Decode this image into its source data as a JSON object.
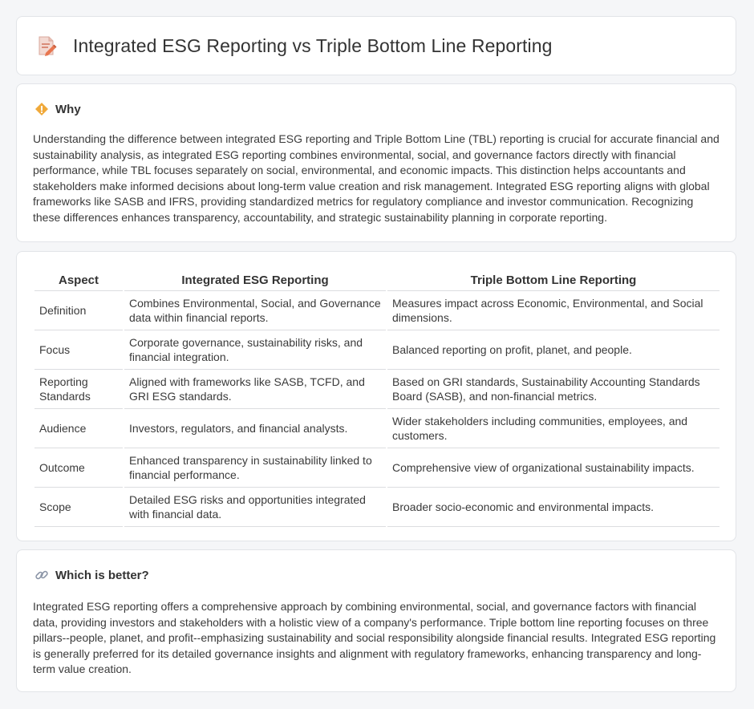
{
  "header": {
    "title": "Integrated ESG Reporting vs Triple Bottom Line Reporting",
    "icon": "document-pencil-icon"
  },
  "why": {
    "title": "Why",
    "icon": "warning-diamond-icon",
    "body": "Understanding the difference between integrated ESG reporting and Triple Bottom Line (TBL) reporting is crucial for accurate financial and sustainability analysis, as integrated ESG reporting combines environmental, social, and governance factors directly with financial performance, while TBL focuses separately on social, environmental, and economic impacts. This distinction helps accountants and stakeholders make informed decisions about long-term value creation and risk management. Integrated ESG reporting aligns with global frameworks like SASB and IFRS, providing standardized metrics for regulatory compliance and investor communication. Recognizing these differences enhances transparency, accountability, and strategic sustainability planning in corporate reporting."
  },
  "table": {
    "headers": [
      "Aspect",
      "Integrated ESG Reporting",
      "Triple Bottom Line Reporting"
    ],
    "rows": [
      [
        "Definition",
        "Combines Environmental, Social, and Governance data within financial reports.",
        "Measures impact across Economic, Environmental, and Social dimensions."
      ],
      [
        "Focus",
        "Corporate governance, sustainability risks, and financial integration.",
        "Balanced reporting on profit, planet, and people."
      ],
      [
        "Reporting Standards",
        "Aligned with frameworks like SASB, TCFD, and GRI ESG standards.",
        "Based on GRI standards, Sustainability Accounting Standards Board (SASB), and non-financial metrics."
      ],
      [
        "Audience",
        "Investors, regulators, and financial analysts.",
        "Wider stakeholders including communities, employees, and customers."
      ],
      [
        "Outcome",
        "Enhanced transparency in sustainability linked to financial performance.",
        "Comprehensive view of organizational sustainability impacts."
      ],
      [
        "Scope",
        "Detailed ESG risks and opportunities integrated with financial data.",
        "Broader socio-economic and environmental impacts."
      ]
    ]
  },
  "better": {
    "title": "Which is better?",
    "icon": "link-icon",
    "body": "Integrated ESG reporting offers a comprehensive approach by combining environmental, social, and governance factors with financial data, providing investors and stakeholders with a holistic view of a company's performance. Triple bottom line reporting focuses on three pillars--people, planet, and profit--emphasizing sustainability and social responsibility alongside financial results. Integrated ESG reporting is generally preferred for its detailed governance insights and alignment with regulatory frameworks, enhancing transparency and long-term value creation."
  }
}
